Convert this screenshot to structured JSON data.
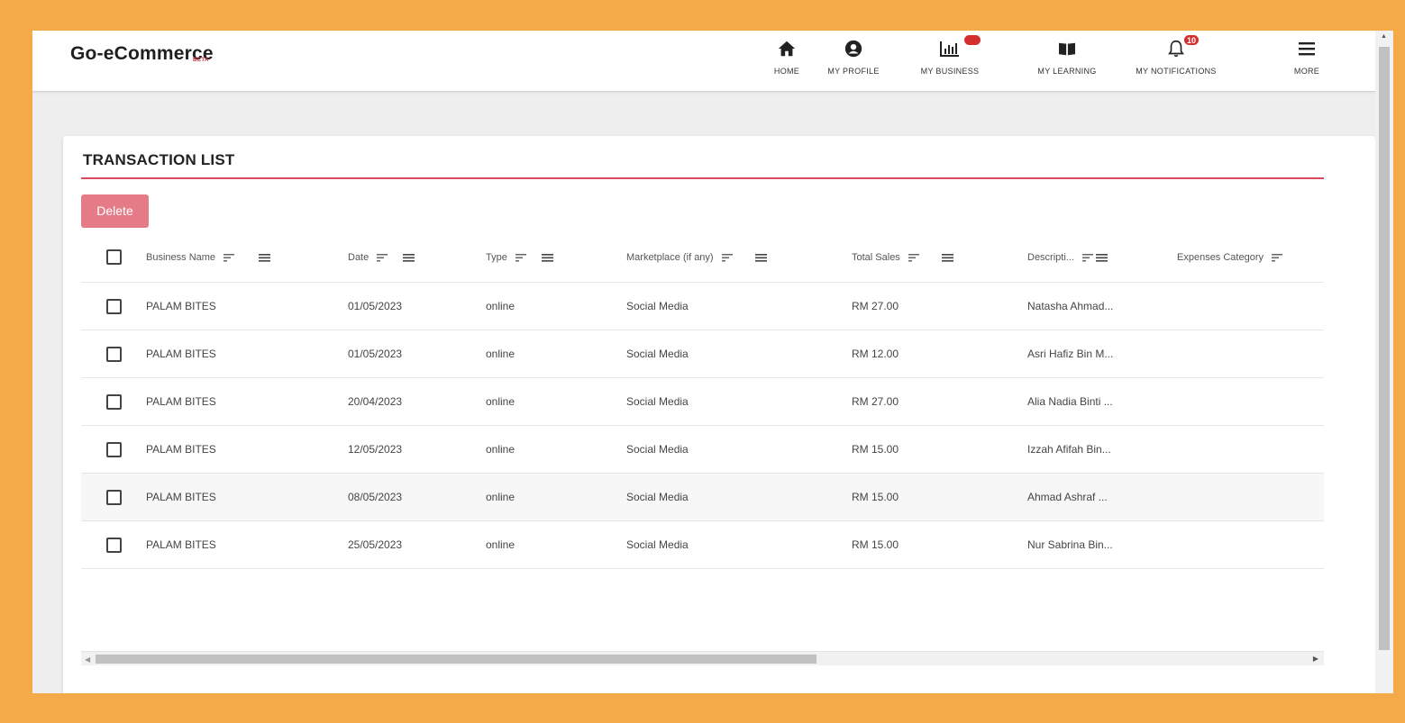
{
  "app": {
    "logo": "Go-eCommerce",
    "beta": "BETA"
  },
  "nav": [
    {
      "label": "HOME",
      "icon": "home-icon"
    },
    {
      "label": "MY PROFILE",
      "icon": "profile-icon"
    },
    {
      "label": "MY BUSINESS",
      "icon": "business-chart-icon",
      "badge": ""
    },
    {
      "label": "MY LEARNING",
      "icon": "book-icon"
    },
    {
      "label": "MY NOTIFICATIONS",
      "icon": "bell-icon",
      "badge": "10"
    },
    {
      "label": "MORE",
      "icon": "menu-icon"
    }
  ],
  "page": {
    "title": "TRANSACTION LIST",
    "delete_label": "Delete"
  },
  "table": {
    "columns": [
      "Business Name",
      "Date",
      "Type",
      "Marketplace (if any)",
      "Total Sales",
      "Descripti...",
      "Expenses Category"
    ],
    "rows": [
      [
        "PALAM BITES",
        "01/05/2023",
        "online",
        "Social Media",
        "RM 27.00",
        "Natasha Ahmad..."
      ],
      [
        "PALAM BITES",
        "01/05/2023",
        "online",
        "Social Media",
        "RM 12.00",
        "Asri Hafiz Bin M..."
      ],
      [
        "PALAM BITES",
        "20/04/2023",
        "online",
        "Social Media",
        "RM 27.00",
        "Alia Nadia Binti ..."
      ],
      [
        "PALAM BITES",
        "12/05/2023",
        "online",
        "Social Media",
        "RM 15.00",
        "Izzah Afifah Bin..."
      ],
      [
        "PALAM BITES",
        "08/05/2023",
        "online",
        "Social Media",
        "RM 15.00",
        "Ahmad Ashraf ..."
      ],
      [
        "PALAM BITES",
        "25/05/2023",
        "online",
        "Social Media",
        "RM 15.00",
        "Nur Sabrina Bin..."
      ]
    ]
  },
  "colors": {
    "frame": "#f5aa4a",
    "accent": "#d94a5b",
    "delete": "#e57b86",
    "badge": "#d32f2f"
  }
}
